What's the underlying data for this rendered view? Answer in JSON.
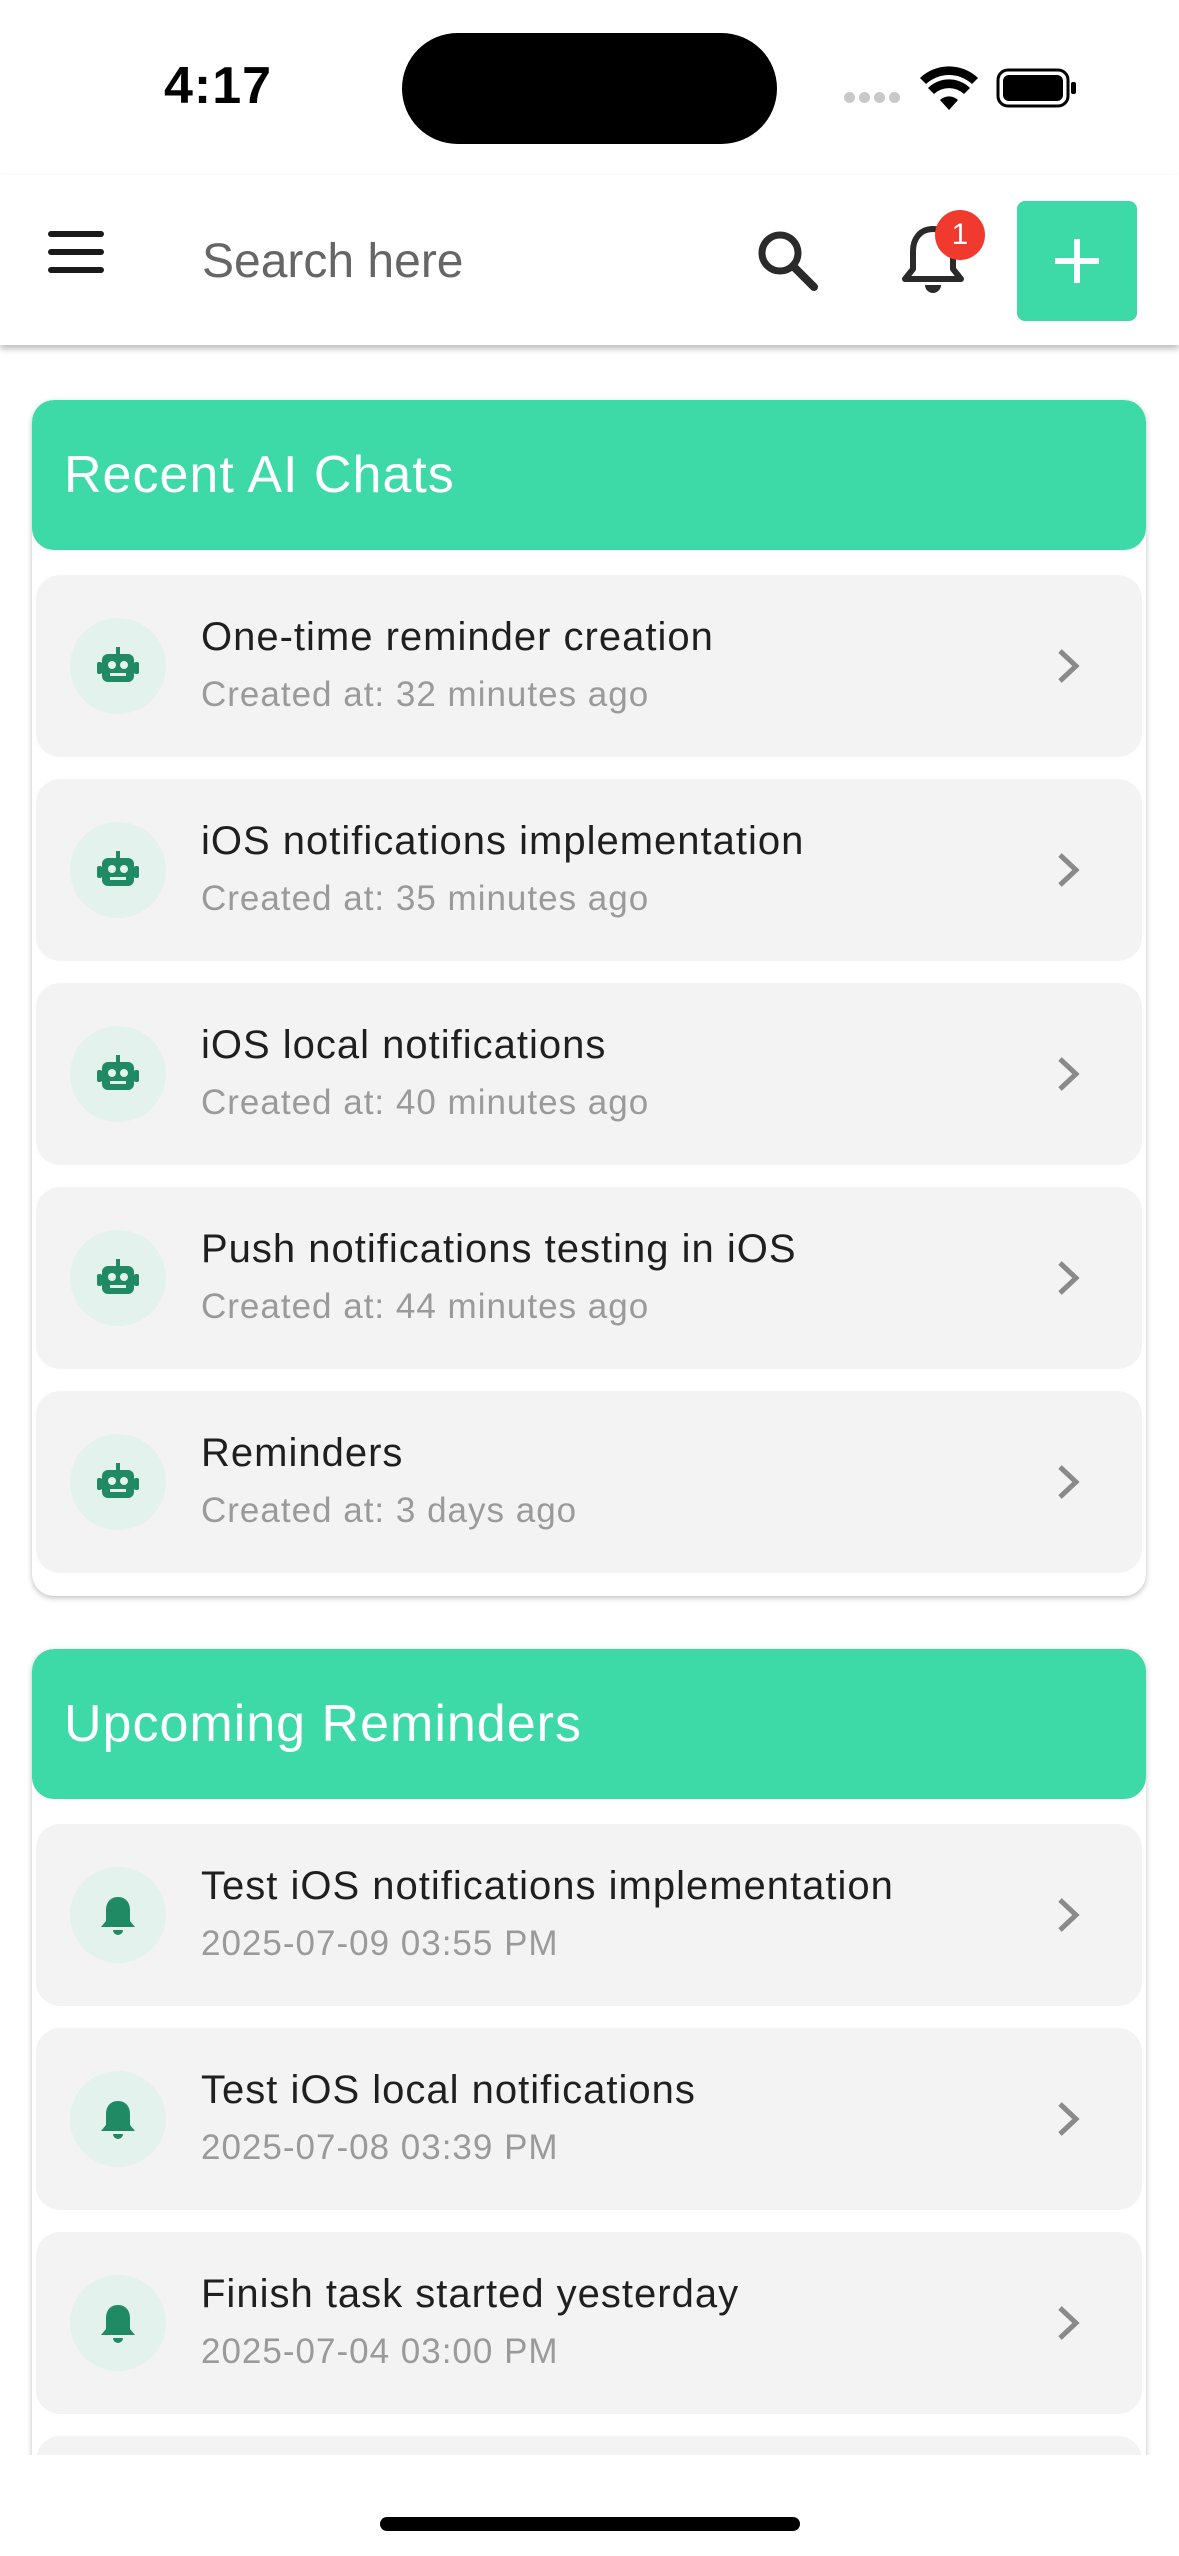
{
  "status_bar": {
    "time": "4:17"
  },
  "header": {
    "search_placeholder": "Search here",
    "notification_count": "1",
    "icons": {
      "menu": "hamburger-menu-icon",
      "search": "search-icon",
      "bell": "bell-icon",
      "add": "plus-icon"
    }
  },
  "colors": {
    "accent": "#3dd9a7",
    "badge": "#f03a2e",
    "icon_green": "#1f8a64"
  },
  "recent_chats": {
    "title": "Recent AI Chats",
    "items": [
      {
        "title": "One-time reminder creation",
        "subtitle": "Created at: 32 minutes ago",
        "icon": "robot-icon"
      },
      {
        "title": "iOS notifications implementation",
        "subtitle": "Created at: 35 minutes ago",
        "icon": "robot-icon"
      },
      {
        "title": "iOS local notifications",
        "subtitle": "Created at: 40 minutes ago",
        "icon": "robot-icon"
      },
      {
        "title": "Push notifications testing in iOS",
        "subtitle": "Created at: 44 minutes ago",
        "icon": "robot-icon"
      },
      {
        "title": "Reminders",
        "subtitle": "Created at: 3 days ago",
        "icon": "robot-icon"
      }
    ]
  },
  "upcoming_reminders": {
    "title": "Upcoming Reminders",
    "items": [
      {
        "title": "Test iOS notifications implementation",
        "subtitle": "2025-07-09 03:55 PM",
        "icon": "bell-icon"
      },
      {
        "title": "Test iOS local notifications",
        "subtitle": "2025-07-08 03:39 PM",
        "icon": "bell-icon"
      },
      {
        "title": "Finish task started yesterday",
        "subtitle": "2025-07-04 03:00 PM",
        "icon": "bell-icon"
      }
    ]
  }
}
